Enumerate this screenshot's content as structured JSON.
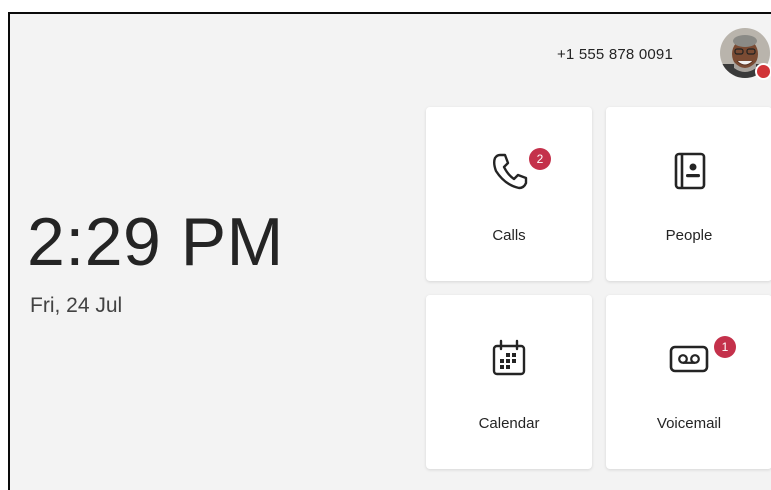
{
  "header": {
    "phone_number": "+1 555 878 0091",
    "avatar_status_color": "#d13438"
  },
  "clock": {
    "time": "2:29 PM",
    "date": "Fri, 24 Jul"
  },
  "tiles": [
    {
      "label": "Calls",
      "icon": "phone-icon",
      "badge": "2"
    },
    {
      "label": "People",
      "icon": "contact-book-icon",
      "badge": ""
    },
    {
      "label": "Calendar",
      "icon": "calendar-icon",
      "badge": ""
    },
    {
      "label": "Voicemail",
      "icon": "voicemail-icon",
      "badge": "1"
    }
  ],
  "colors": {
    "badge": "#c4314b",
    "background": "#f3f3f3",
    "tile": "#ffffff"
  }
}
